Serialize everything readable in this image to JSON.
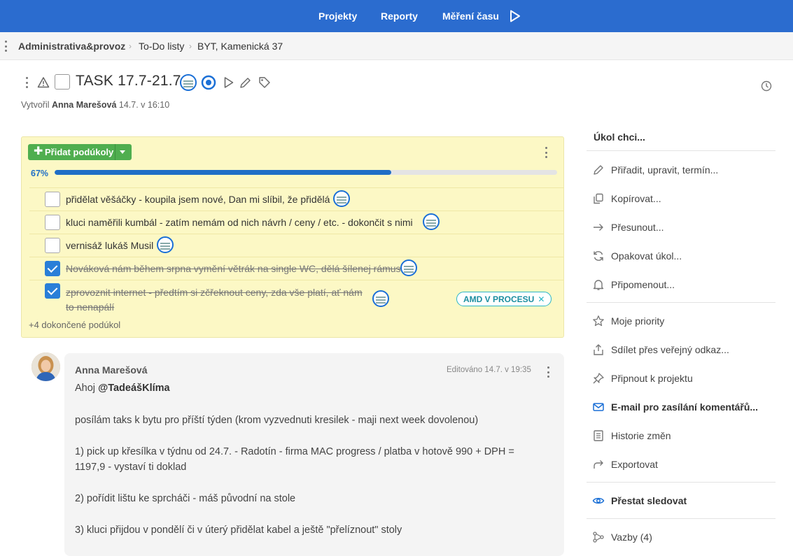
{
  "topnav": {
    "projects": "Projekty",
    "reports": "Reporty",
    "time_tracking": "Měření času",
    "accent": "#2b6ccf"
  },
  "breadcrumb": [
    "Administrativa&provoz",
    "To-Do listy",
    "BYT, Kamenická 37"
  ],
  "task": {
    "title": "TASK 17.7-21.7.",
    "created_prefix": "Vytvořil",
    "created_by": "Anna Marešová",
    "created_at": "14.7. v 16:10"
  },
  "checklist": {
    "add_button": "Přidat podúkoly",
    "progress_label": "67%",
    "progress_value": 0.67,
    "items": [
      {
        "text": "přidělat věšáčky - koupila jsem nové, Dan mi slíbil, že přidělá",
        "done": false
      },
      {
        "text": "kluci naměřili kumbál - zatím nemám od nich návrh / ceny / etc. - dokončit s nimi",
        "done": false
      },
      {
        "text": "vernisáž lukáš Musil",
        "done": false
      },
      {
        "text": "Nováková nám během srpna vymění větrák na single WC, dělá šílenej rámus",
        "done": true
      },
      {
        "text_line1": "zprovoznit internet - předtím si zčřeknout ceny, zda vše platí, ať nám",
        "text_line2": "to nenapálí",
        "done": true,
        "tag": "AMD V PROCESU"
      }
    ],
    "more_done": "+4 dokončené podúkol"
  },
  "comment": {
    "author": "Anna Marešová",
    "edited": "Editováno 14.7. v 19:35",
    "greeting": "Ahoj ",
    "mention": "@TadeášKlíma",
    "lines": [
      "posílám taks k bytu pro příští týden (krom vyzvednuti kresilek - maji next week dovolenou)",
      "1) pick up křesílka v týdnu od 24.7. - Radotín - firma MAC progress / platba v hotově 990 + DPH =",
      "1197,9 - vystaví ti doklad",
      "2) pořídit lištu ke sprcháči - máš původní na stole",
      "3) kluci přijdou v pondělí či v úterý přidělat kabel a ještě \"přelíznout\" stoly"
    ]
  },
  "side_menu": {
    "heading": "Úkol chci...",
    "items": [
      {
        "label": "Přiřadit, upravit, termín...",
        "icon": "pencil-icon"
      },
      {
        "label": "Kopírovat...",
        "icon": "copy-icon"
      },
      {
        "label": "Přesunout...",
        "icon": "arrow-right-icon"
      },
      {
        "label": "Opakovat úkol...",
        "icon": "repeat-icon"
      },
      {
        "label": "Připomenout...",
        "icon": "bell-icon"
      },
      {
        "label": "Moje priority",
        "icon": "star-icon"
      },
      {
        "label": "Sdílet přes veřejný odkaz...",
        "icon": "share-icon"
      },
      {
        "label": "Připnout k projektu",
        "icon": "pin-icon"
      },
      {
        "label": "E-mail pro zasílání komentářů...",
        "icon": "mail-icon"
      },
      {
        "label": "Historie změn",
        "icon": "history-icon"
      },
      {
        "label": "Exportovat",
        "icon": "export-icon"
      },
      {
        "label": "Přestat sledovat",
        "icon": "eye-icon"
      },
      {
        "label": "Vazby (4)",
        "icon": "links-icon"
      }
    ]
  }
}
